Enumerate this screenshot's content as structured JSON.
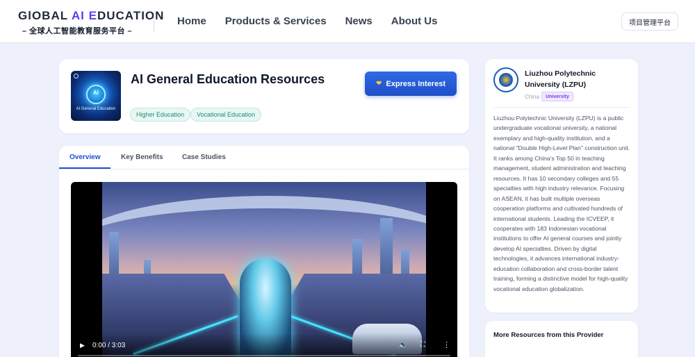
{
  "header": {
    "logo_prefix": "GlOBAL ",
    "logo_ai": "AI",
    "logo_suffix_e": " E",
    "logo_suffix_rest": "DUCATION",
    "logo_subtitle": "– 全球人工智能教育服务平台 –",
    "nav": [
      "Home",
      "Products & Services",
      "News",
      "About Us"
    ],
    "platform_button": "项目管理平台"
  },
  "resource": {
    "thumbnail_text": "AI",
    "thumbnail_caption": "AI General Education",
    "title": "AI General Education Resources",
    "tags": [
      "Higher Education",
      "Vocational Education"
    ],
    "express_button": "Express Interest",
    "express_icon": "heart-icon"
  },
  "tabs": {
    "items": [
      "Overview",
      "Key Benefits",
      "Case Studies"
    ],
    "active": "Overview"
  },
  "video": {
    "time": "0:00 / 3:03",
    "progress_fraction": 0.0
  },
  "provider": {
    "name": "Liuzhou Polytechnic University (LZPU)",
    "country": "China",
    "type_badge": "University",
    "description": "Liuzhou Polytechnic University (LZPU) is a public undergraduate vocational university, a national exemplary and high-quality institution, and a national \"Double High-Level Plan\" construction unit. It ranks among China’s Top 50 in teaching management, student administration and teaching resources. It has 10 secondary colleges and 55 specialties with high industry relevance. Focusing on ASEAN, it has built multiple overseas cooperation platforms and cultivated hundreds of international students. Leading the ICVEEP, it cooperates with 183 Indonesian vocational institutions to offer AI general courses and jointly develop AI specialties. Driven by digital technologies, it advances international industry-education collaboration and cross-border talent training, forming a distinctive model for high-quality vocational education globalization."
  },
  "more_resources": {
    "title": "More Resources from this Provider"
  },
  "colors": {
    "accent_blue": "#1d4ed8",
    "brand_purple": "#5b3df5",
    "tag_green": "#1f8a72",
    "badge_purple": "#7c3aed"
  }
}
